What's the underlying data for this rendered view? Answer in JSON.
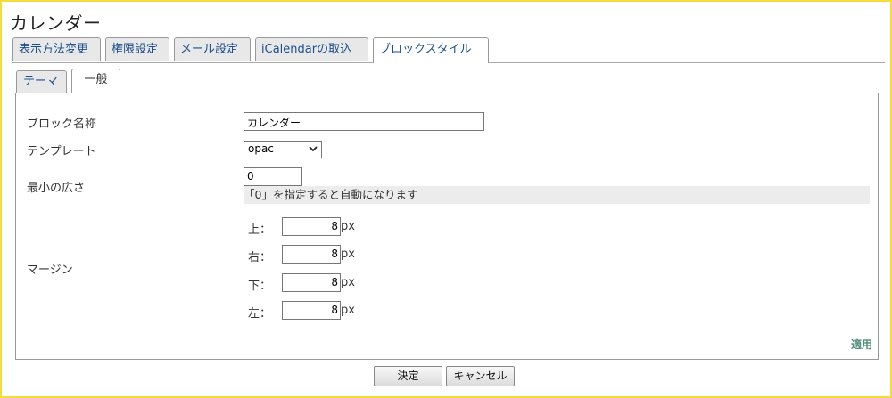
{
  "window": {
    "title": "カレンダー"
  },
  "main_tabs": [
    {
      "label": "表示方法変更"
    },
    {
      "label": "権限設定"
    },
    {
      "label": "メール設定"
    },
    {
      "label": "iCalendarの取込"
    },
    {
      "label": "ブロックスタイル"
    }
  ],
  "main_tab_active": "ブロックスタイル",
  "sub_tabs": [
    {
      "label": "テーマ"
    },
    {
      "label": "一般"
    }
  ],
  "sub_tab_active": "一般",
  "form": {
    "block_name": {
      "label": "ブロック名称",
      "value": "カレンダー"
    },
    "template": {
      "label": "テンプレート",
      "selected": "opac"
    },
    "min_width": {
      "label": "最小の広さ",
      "value": "0",
      "hint": "「0」を指定すると自動になります"
    },
    "margin": {
      "label": "マージン",
      "unit": "px",
      "top": {
        "label": "上：",
        "value": "8"
      },
      "right": {
        "label": "右：",
        "value": "8"
      },
      "bottom": {
        "label": "下：",
        "value": "8"
      },
      "left": {
        "label": "左：",
        "value": "8"
      }
    },
    "apply_label": "適用"
  },
  "buttons": {
    "ok": "決定",
    "cancel": "キャンセル"
  },
  "colors": {
    "frame_border": "#f5dc3c",
    "tab_text": "#1a4f8b",
    "apply_link": "#4f8a7a"
  },
  "icons": {
    "dropdown": "chevron-down-icon"
  }
}
